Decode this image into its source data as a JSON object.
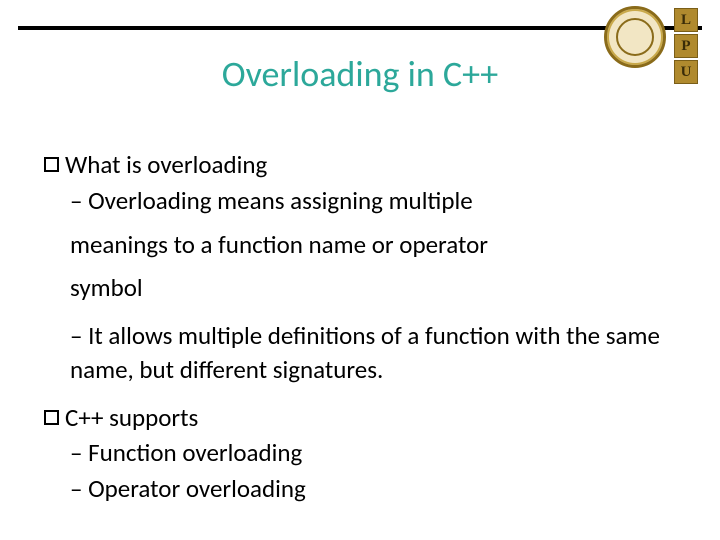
{
  "logos": {
    "l": "L",
    "p": "P",
    "u": "U"
  },
  "title": "Overloading in C++",
  "content": {
    "b1": {
      "label": "What is overloading",
      "s1": "– Overloading means assigning multiple",
      "s1b": "meanings to a function name or operator",
      "s1c": "symbol",
      "s2": "– It allows multiple definitions of a function with the same name, but different signatures."
    },
    "b2": {
      "label": "C++ supports",
      "s1": "– Function overloading",
      "s2": "– Operator overloading"
    }
  }
}
